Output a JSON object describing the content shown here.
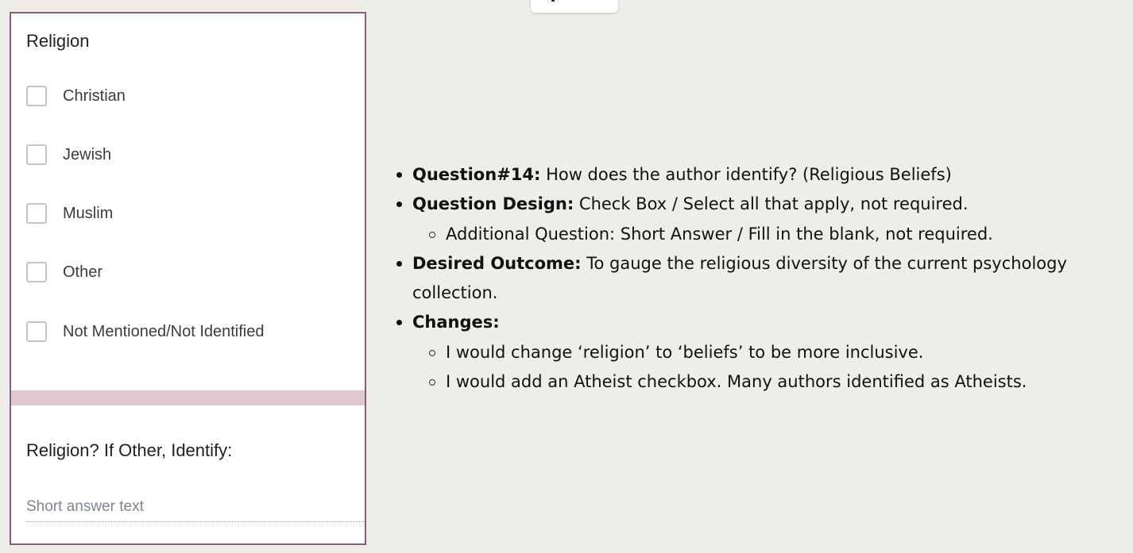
{
  "form": {
    "question1": {
      "title": "Religion",
      "options": [
        {
          "label": "Christian",
          "checked": false
        },
        {
          "label": "Jewish",
          "checked": false
        },
        {
          "label": "Muslim",
          "checked": false
        },
        {
          "label": "Other",
          "checked": false
        },
        {
          "label": "Not Mentioned/Not Identified",
          "checked": false
        }
      ]
    },
    "question2": {
      "title": "Religion? If Other, Identify:",
      "placeholder": "Short answer text",
      "value": ""
    }
  },
  "notes": {
    "items": [
      {
        "label": "Question#14:",
        "text": " How does the author identify? (Religious Beliefs)"
      },
      {
        "label": "Question Design:",
        "text": " Check Box / Select all that apply, not required.",
        "sub": [
          "Additional Question: Short Answer / Fill in the blank, not required."
        ]
      },
      {
        "label": "Desired Outcome:",
        "text": " To gauge the religious diversity of the current psychology collection."
      },
      {
        "label": "Changes:",
        "text": "",
        "sub": [
          "I would change ‘religion’ to ‘beliefs’ to be more inclusive.",
          "I would add an Atheist checkbox. Many authors identified as Atheists."
        ]
      }
    ]
  },
  "colors": {
    "card_border": "#8a5d7f",
    "section_band": "#e0c9ce",
    "page_background": "#efede7"
  }
}
